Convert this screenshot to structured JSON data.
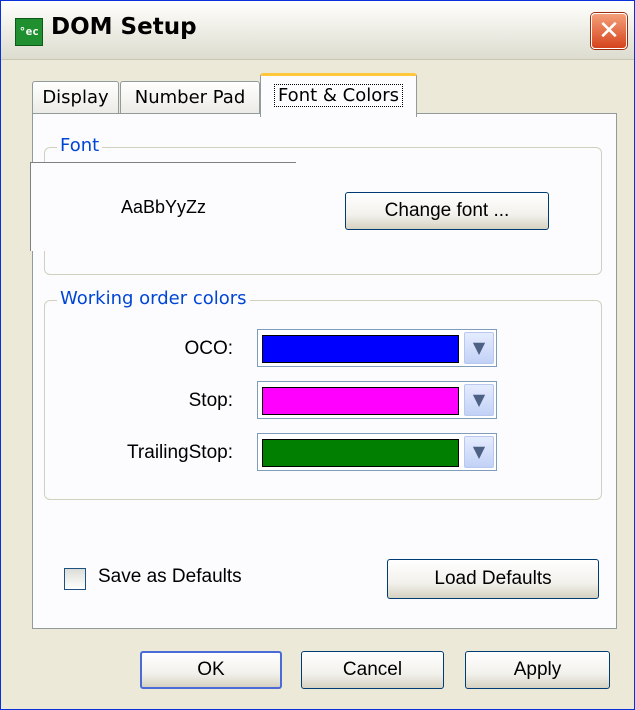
{
  "window": {
    "title": "DOM Setup",
    "icon": "app-icon",
    "app_icon_text": "°ec"
  },
  "tabs": [
    {
      "label": "Display"
    },
    {
      "label": "Number Pad"
    },
    {
      "label": "Font & Colors",
      "active": true
    }
  ],
  "font_group": {
    "label": "Font",
    "sample_text": "AaBbYyZz",
    "change_button": "Change font ..."
  },
  "colors_group": {
    "label": "Working order colors",
    "rows": [
      {
        "label": "OCO:",
        "color": "#0000ff"
      },
      {
        "label": "Stop:",
        "color": "#ff00ff"
      },
      {
        "label": "TrailingStop:",
        "color": "#007f00"
      }
    ]
  },
  "defaults": {
    "save_label": "Save as Defaults",
    "save_checked": false,
    "load_button": "Load Defaults"
  },
  "footer": {
    "ok": "OK",
    "cancel": "Cancel",
    "apply": "Apply"
  },
  "colors": {
    "accent_tab": "#ffc83c",
    "group_label": "#0046d5",
    "title_bar_border": "#0831d9"
  }
}
